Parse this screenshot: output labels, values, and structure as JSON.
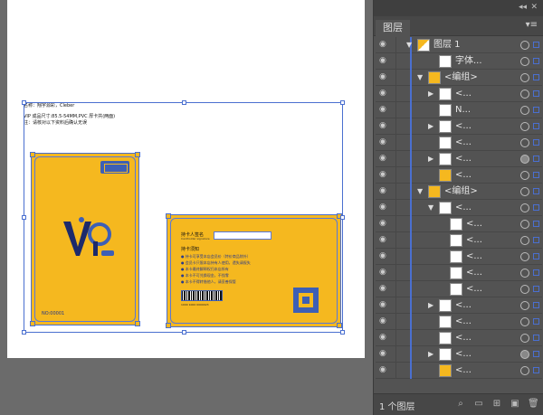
{
  "artboard": {
    "header_note_1": "名称：翔宇源彩，Cleber",
    "header_note_2": "VIP 成品尺寸:85.5-54MM,PVC 厚卡共(两面)",
    "header_note_3": "注：请核对以下资料后确认无误",
    "front_card": {
      "number_label": "NO:00001"
    },
    "back_card": {
      "holder_label": "持卡人签名",
      "holder_sub": "Cardholder signature",
      "notice_title": "持卡须知",
      "rules": [
        "● 持卡可享受本店会员价（特价商品除外）",
        "● 会员卡只限本店持有人使用，遗失请报失",
        "● 本卡最终解释权归本店所有",
        "● 本卡不可兑换现金，不找零",
        "● 本卡不得转借他人，请妥善保管"
      ],
      "barcode_number": "1000 1000 0000023"
    }
  },
  "layers_panel": {
    "tab_label": "图层",
    "footer_count": "1 个图层",
    "rows": [
      {
        "label": "图层 1",
        "arrow": "▼",
        "indent": 0,
        "thumb": "layer",
        "target": "ring"
      },
      {
        "label": "字体...",
        "arrow": "",
        "indent": 2,
        "thumb": "white",
        "target": "ring"
      },
      {
        "label": "<编组>",
        "arrow": "▼",
        "indent": 1,
        "thumb": "orange",
        "target": "ring"
      },
      {
        "label": "<...",
        "arrow": "▶",
        "indent": 2,
        "thumb": "white",
        "target": "ring"
      },
      {
        "label": "N...",
        "arrow": "",
        "indent": 2,
        "thumb": "white",
        "target": "ring"
      },
      {
        "label": "<...",
        "arrow": "▶",
        "indent": 2,
        "thumb": "white",
        "target": "ring"
      },
      {
        "label": "<...",
        "arrow": "",
        "indent": 2,
        "thumb": "white",
        "target": "ring"
      },
      {
        "label": "<...",
        "arrow": "▶",
        "indent": 2,
        "thumb": "white",
        "target": "filled"
      },
      {
        "label": "<...",
        "arrow": "",
        "indent": 2,
        "thumb": "orange",
        "target": "ring"
      },
      {
        "label": "<编组>",
        "arrow": "▼",
        "indent": 1,
        "thumb": "orange",
        "target": "ring"
      },
      {
        "label": "<...",
        "arrow": "▼",
        "indent": 2,
        "thumb": "white",
        "target": "ring"
      },
      {
        "label": "<...",
        "arrow": "",
        "indent": 3,
        "thumb": "white",
        "target": "ring"
      },
      {
        "label": "<...",
        "arrow": "",
        "indent": 3,
        "thumb": "white",
        "target": "ring"
      },
      {
        "label": "<...",
        "arrow": "",
        "indent": 3,
        "thumb": "white",
        "target": "ring"
      },
      {
        "label": "<...",
        "arrow": "",
        "indent": 3,
        "thumb": "white",
        "target": "ring"
      },
      {
        "label": "<...",
        "arrow": "",
        "indent": 3,
        "thumb": "white",
        "target": "ring"
      },
      {
        "label": "<...",
        "arrow": "▶",
        "indent": 2,
        "thumb": "white",
        "target": "ring"
      },
      {
        "label": "<...",
        "arrow": "",
        "indent": 2,
        "thumb": "white",
        "target": "ring"
      },
      {
        "label": "<...",
        "arrow": "",
        "indent": 2,
        "thumb": "white",
        "target": "ring"
      },
      {
        "label": "<...",
        "arrow": "▶",
        "indent": 2,
        "thumb": "white",
        "target": "filled"
      },
      {
        "label": "<...",
        "arrow": "",
        "indent": 2,
        "thumb": "orange",
        "target": "ring"
      }
    ]
  },
  "colors": {
    "card_fill": "#f5b81f",
    "selection": "#4a6fd0",
    "panel_bg": "#535353"
  }
}
